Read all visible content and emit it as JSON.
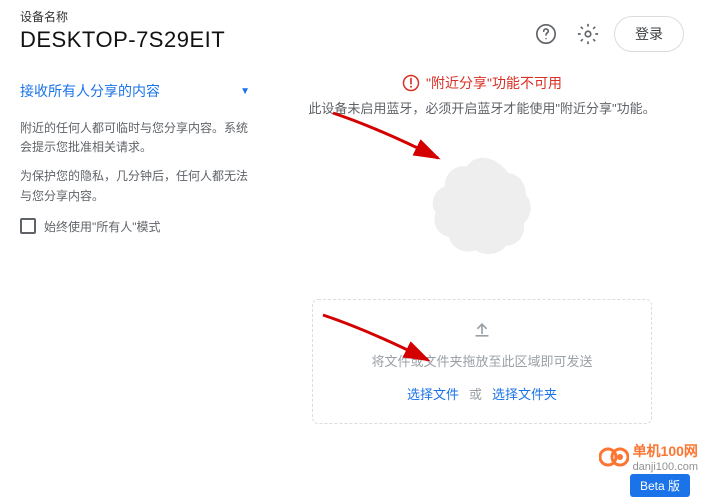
{
  "header": {
    "device_label": "设备名称",
    "device_name": "DESKTOP-7S29EIT",
    "login_label": "登录"
  },
  "sidebar": {
    "dropdown_label": "接收所有人分享的内容",
    "paragraph1": "附近的任何人都可临时与您分享内容。系统会提示您批准相关请求。",
    "paragraph2": "为保护您的隐私，几分钟后，任何人都无法与您分享内容。",
    "checkbox_label": "始终使用\"所有人\"模式"
  },
  "main": {
    "alert_title": "\"附近分享\"功能不可用",
    "alert_desc": "此设备未启用蓝牙，必须开启蓝牙才能使用\"附近分享\"功能。",
    "drop_text": "将文件或文件夹拖放至此区域即可发送",
    "select_files": "选择文件",
    "select_sep": "或",
    "select_folder": "选择文件夹"
  },
  "footer": {
    "beta_label": "Beta 版",
    "watermark_brand": "单机100网",
    "watermark_url": "danji100.com"
  }
}
